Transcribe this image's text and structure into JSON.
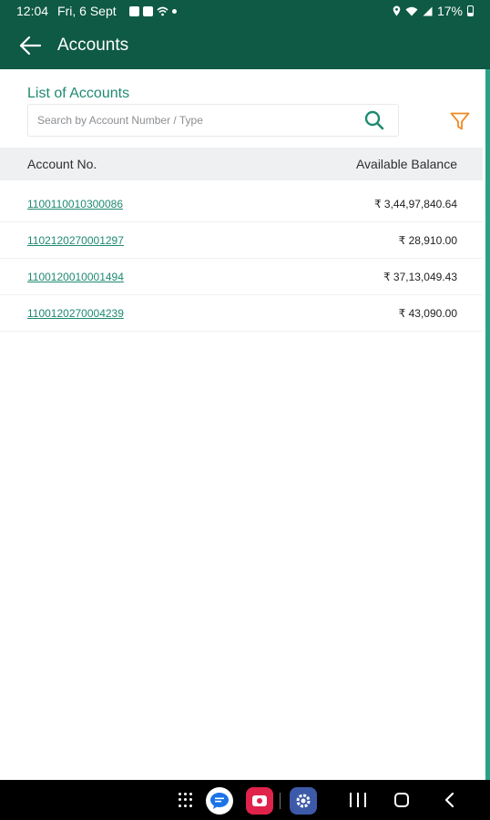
{
  "status_bar": {
    "time": "12:04",
    "date": "Fri, 6 Sept",
    "battery": "17%"
  },
  "app_bar": {
    "title": "Accounts",
    "back_icon": "arrow-left-icon"
  },
  "list": {
    "title": "List of Accounts",
    "search_placeholder": "Search by Account Number / Type",
    "search_value": "",
    "search_icon": "search-icon",
    "filter_icon": "filter-icon"
  },
  "table": {
    "columns": [
      "Account No.",
      "Available Balance"
    ],
    "rows": [
      {
        "account": "1100110010300086",
        "balance": "₹ 3,44,97,840.64"
      },
      {
        "account": "1102120270001297",
        "balance": "₹ 28,910.00"
      },
      {
        "account": "1100120010001494",
        "balance": "₹ 37,13,049.43"
      },
      {
        "account": "1100120270004239",
        "balance": "₹ 43,090.00"
      }
    ]
  },
  "colors": {
    "brand": "#0f5a44",
    "accent": "#1f8a70",
    "filter": "#f08a24"
  }
}
